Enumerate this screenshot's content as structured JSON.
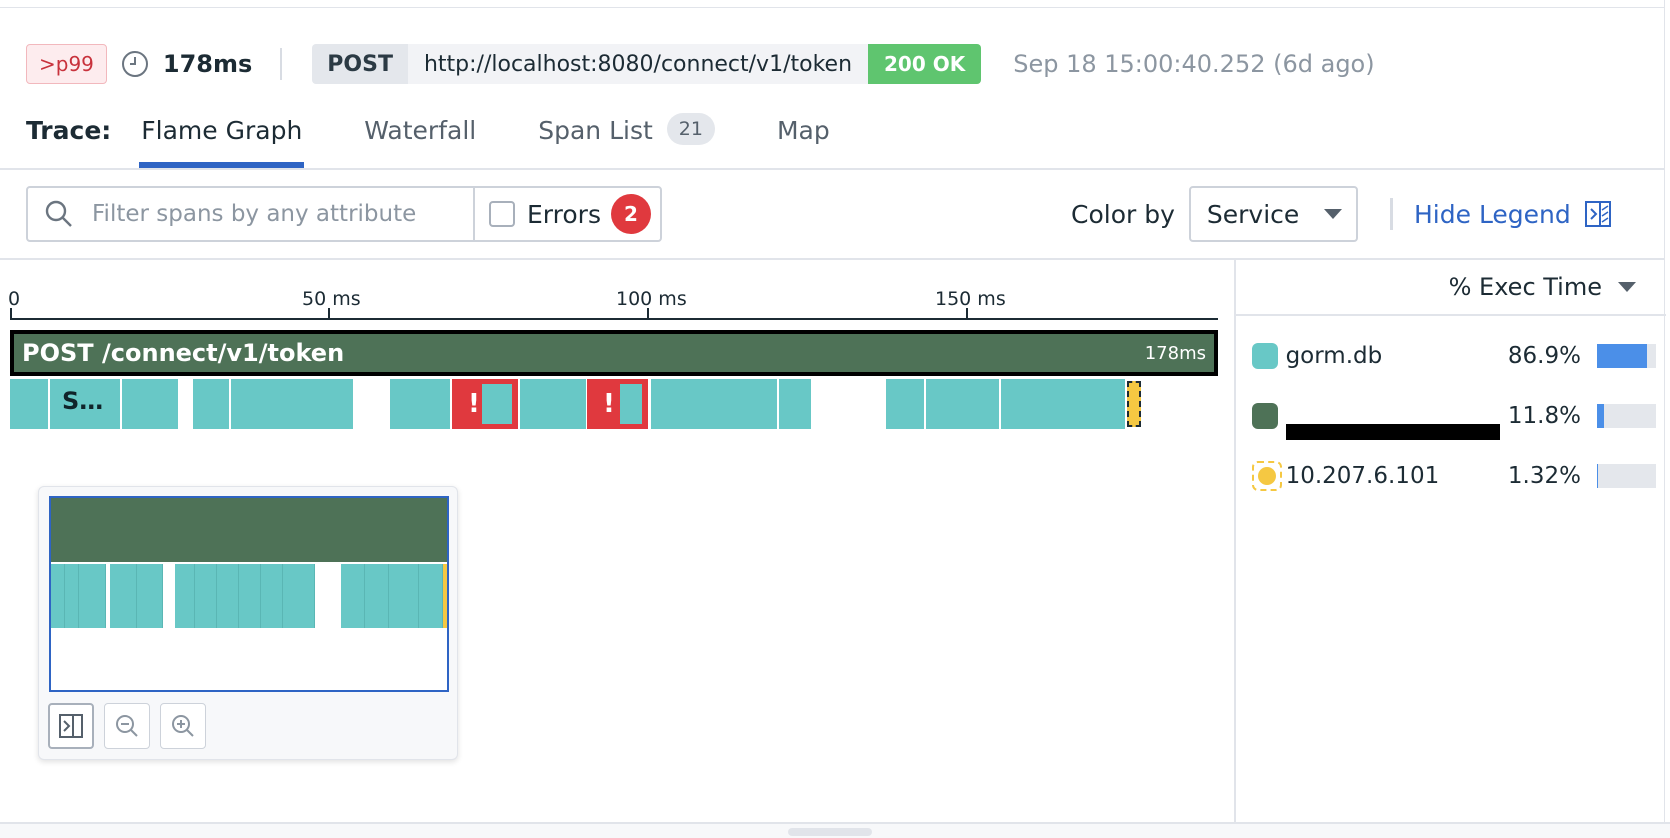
{
  "header": {
    "percentile_badge": ">p99",
    "duration": "178ms",
    "method": "POST",
    "url": "http://localhost:8080/connect/v1/token",
    "status": "200 OK",
    "timestamp": "Sep 18 15:00:40.252 (6d ago)"
  },
  "tabs": {
    "label": "Trace:",
    "items": [
      {
        "label": "Flame Graph",
        "active": true
      },
      {
        "label": "Waterfall"
      },
      {
        "label": "Span List",
        "count": "21"
      },
      {
        "label": "Map"
      }
    ]
  },
  "filter": {
    "placeholder": "Filter spans by any attribute",
    "errors_label": "Errors",
    "errors_count": "2",
    "errors_checked": false
  },
  "color_by": {
    "label": "Color by",
    "selected": "Service"
  },
  "hide_legend": "Hide Legend",
  "flame_graph": {
    "axis_ticks": [
      "0",
      "50 ms",
      "100 ms",
      "150 ms"
    ],
    "root_span": {
      "name": "POST  /connect/v1/token",
      "duration": "178ms"
    },
    "child_label": "S…"
  },
  "legend": {
    "header": "% Exec Time",
    "items": [
      {
        "name": "gorm.db",
        "pct": "86.9%",
        "fraction": 0.869,
        "color": "#68c8c6"
      },
      {
        "name": "",
        "pct": "11.8%",
        "fraction": 0.118,
        "color": "#4e7257",
        "redacted": true
      },
      {
        "name": "10.207.6.101",
        "pct": "1.32%",
        "fraction": 0.0132,
        "color": "#f5c842"
      }
    ]
  },
  "colors": {
    "accent": "#2e64c4",
    "root_span": "#4e7257",
    "db_span": "#68c8c6",
    "error": "#e0393e",
    "status_ok": "#5fc56f"
  }
}
